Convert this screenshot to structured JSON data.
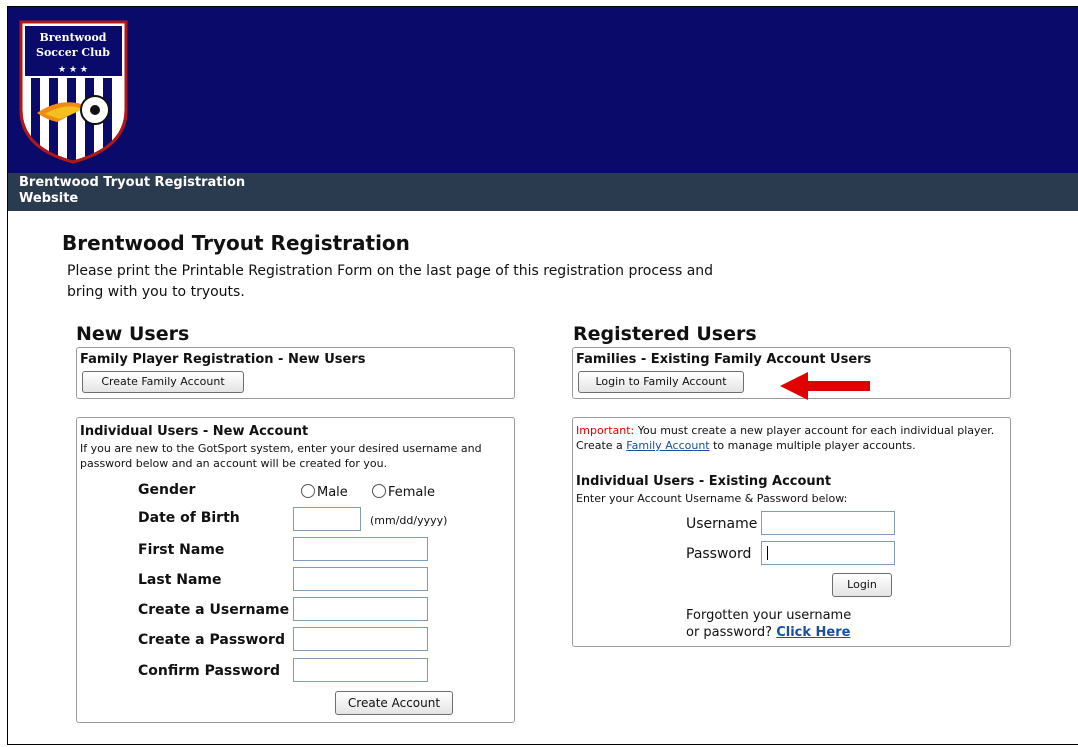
{
  "header": {
    "logo_text_line1": "Brentwood",
    "logo_text_line2": "Soccer Club",
    "site_title": "Brentwood Tryout Registration Website"
  },
  "page": {
    "title": "Brentwood Tryout Registration",
    "intro": "Please print the Printable Registration Form on the last page of this registration process and bring with you to tryouts."
  },
  "new_users": {
    "heading": "New Users",
    "family_box": {
      "title": "Family Player Registration - New Users",
      "button": "Create Family Account"
    },
    "individual_box": {
      "title": "Individual Users - New Account",
      "description": "If you are new to the GotSport system, enter your desired username and password below and an account will be created for you.",
      "gender_label": "Gender",
      "gender_options": [
        "Male",
        "Female"
      ],
      "dob_label": "Date of Birth",
      "dob_hint": "(mm/dd/yyyy)",
      "first_name_label": "First Name",
      "last_name_label": "Last Name",
      "username_label": "Create a Username",
      "password_label": "Create a Password",
      "confirm_label": "Confirm Password",
      "submit_button": "Create Account"
    }
  },
  "registered_users": {
    "heading": "Registered Users",
    "family_box": {
      "title": "Families - Existing Family Account Users",
      "button": "Login to Family Account"
    },
    "login_box": {
      "important_label": "Important:",
      "important_text_1": "You must create a new player account for each individual player. Create a",
      "family_account_link": "Family Account",
      "important_text_2": "to manage multiple player accounts.",
      "title": "Individual Users - Existing Account",
      "subtitle": "Enter your Account Username & Password below:",
      "username_label": "Username",
      "password_label": "Password",
      "login_button": "Login",
      "forgot_line1": "Forgotten your username",
      "forgot_line2": "or password?",
      "forgot_link": "Click Here"
    }
  },
  "colors": {
    "banner": "#0a0a6a",
    "subbar": "#2a3b50",
    "arrow": "#e00000",
    "link": "#1a4fa0"
  }
}
